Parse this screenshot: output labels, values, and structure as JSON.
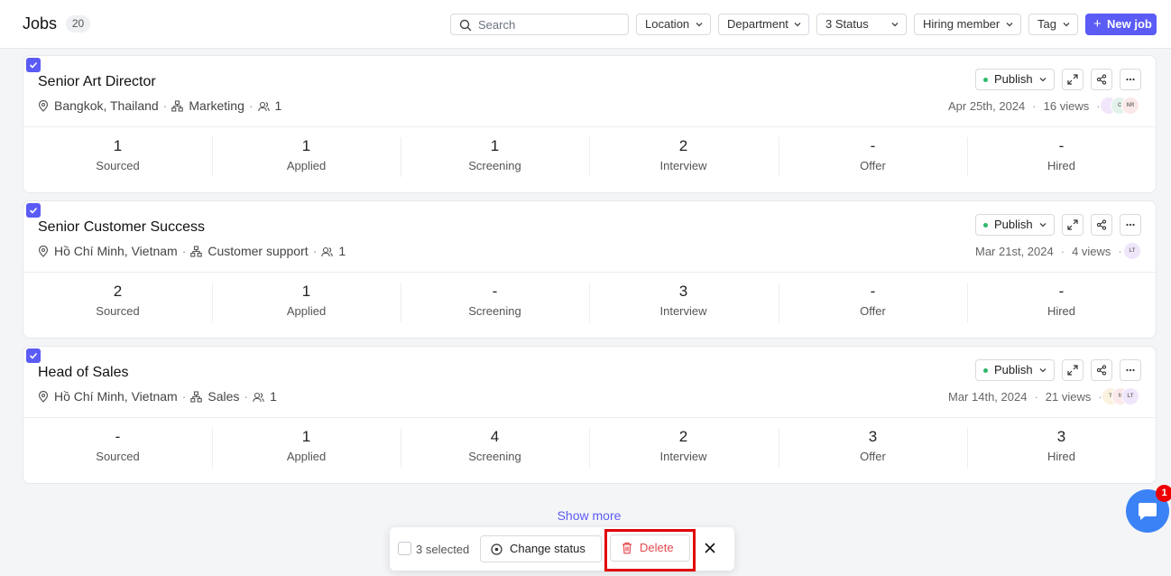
{
  "header": {
    "title": "Jobs",
    "count": "20",
    "search_placeholder": "Search",
    "filters": [
      "Location",
      "Department",
      "3 Status",
      "Hiring member",
      "Tag"
    ],
    "new_job_label": "New job"
  },
  "jobs": [
    {
      "title": "Senior Art Director",
      "location": "Bangkok, Thailand",
      "department": "Marketing",
      "members": "1",
      "status": "Publish",
      "date": "Apr 25th, 2024",
      "views": "16 views",
      "avatars": [
        "",
        "C",
        "NR"
      ],
      "stats": [
        {
          "value": "1",
          "label": "Sourced"
        },
        {
          "value": "1",
          "label": "Applied"
        },
        {
          "value": "1",
          "label": "Screening"
        },
        {
          "value": "2",
          "label": "Interview"
        },
        {
          "value": "-",
          "label": "Offer"
        },
        {
          "value": "-",
          "label": "Hired"
        }
      ]
    },
    {
      "title": "Senior Customer Success",
      "location": "Hồ Chí Minh, Vietnam",
      "department": "Customer support",
      "members": "1",
      "status": "Publish",
      "date": "Mar 21st, 2024",
      "views": "4 views",
      "avatars": [
        "LT"
      ],
      "stats": [
        {
          "value": "2",
          "label": "Sourced"
        },
        {
          "value": "1",
          "label": "Applied"
        },
        {
          "value": "-",
          "label": "Screening"
        },
        {
          "value": "3",
          "label": "Interview"
        },
        {
          "value": "-",
          "label": "Offer"
        },
        {
          "value": "-",
          "label": "Hired"
        }
      ]
    },
    {
      "title": "Head of Sales",
      "location": "Hồ Chí Minh, Vietnam",
      "department": "Sales",
      "members": "1",
      "status": "Publish",
      "date": "Mar 14th, 2024",
      "views": "21 views",
      "avatars": [
        "T",
        "N",
        "LT"
      ],
      "stats": [
        {
          "value": "-",
          "label": "Sourced"
        },
        {
          "value": "1",
          "label": "Applied"
        },
        {
          "value": "4",
          "label": "Screening"
        },
        {
          "value": "2",
          "label": "Interview"
        },
        {
          "value": "3",
          "label": "Offer"
        },
        {
          "value": "3",
          "label": "Hired"
        }
      ]
    }
  ],
  "show_more": "Show more",
  "action_bar": {
    "selected": "3 selected",
    "change_status": "Change status",
    "delete": "Delete"
  },
  "chat_badge": "1",
  "colors": {
    "accent": "#5b5bf5",
    "publish_dot": "#2fb86a",
    "delete": "#e5484d",
    "highlight": "#e00000",
    "chat": "#3b82f6"
  }
}
